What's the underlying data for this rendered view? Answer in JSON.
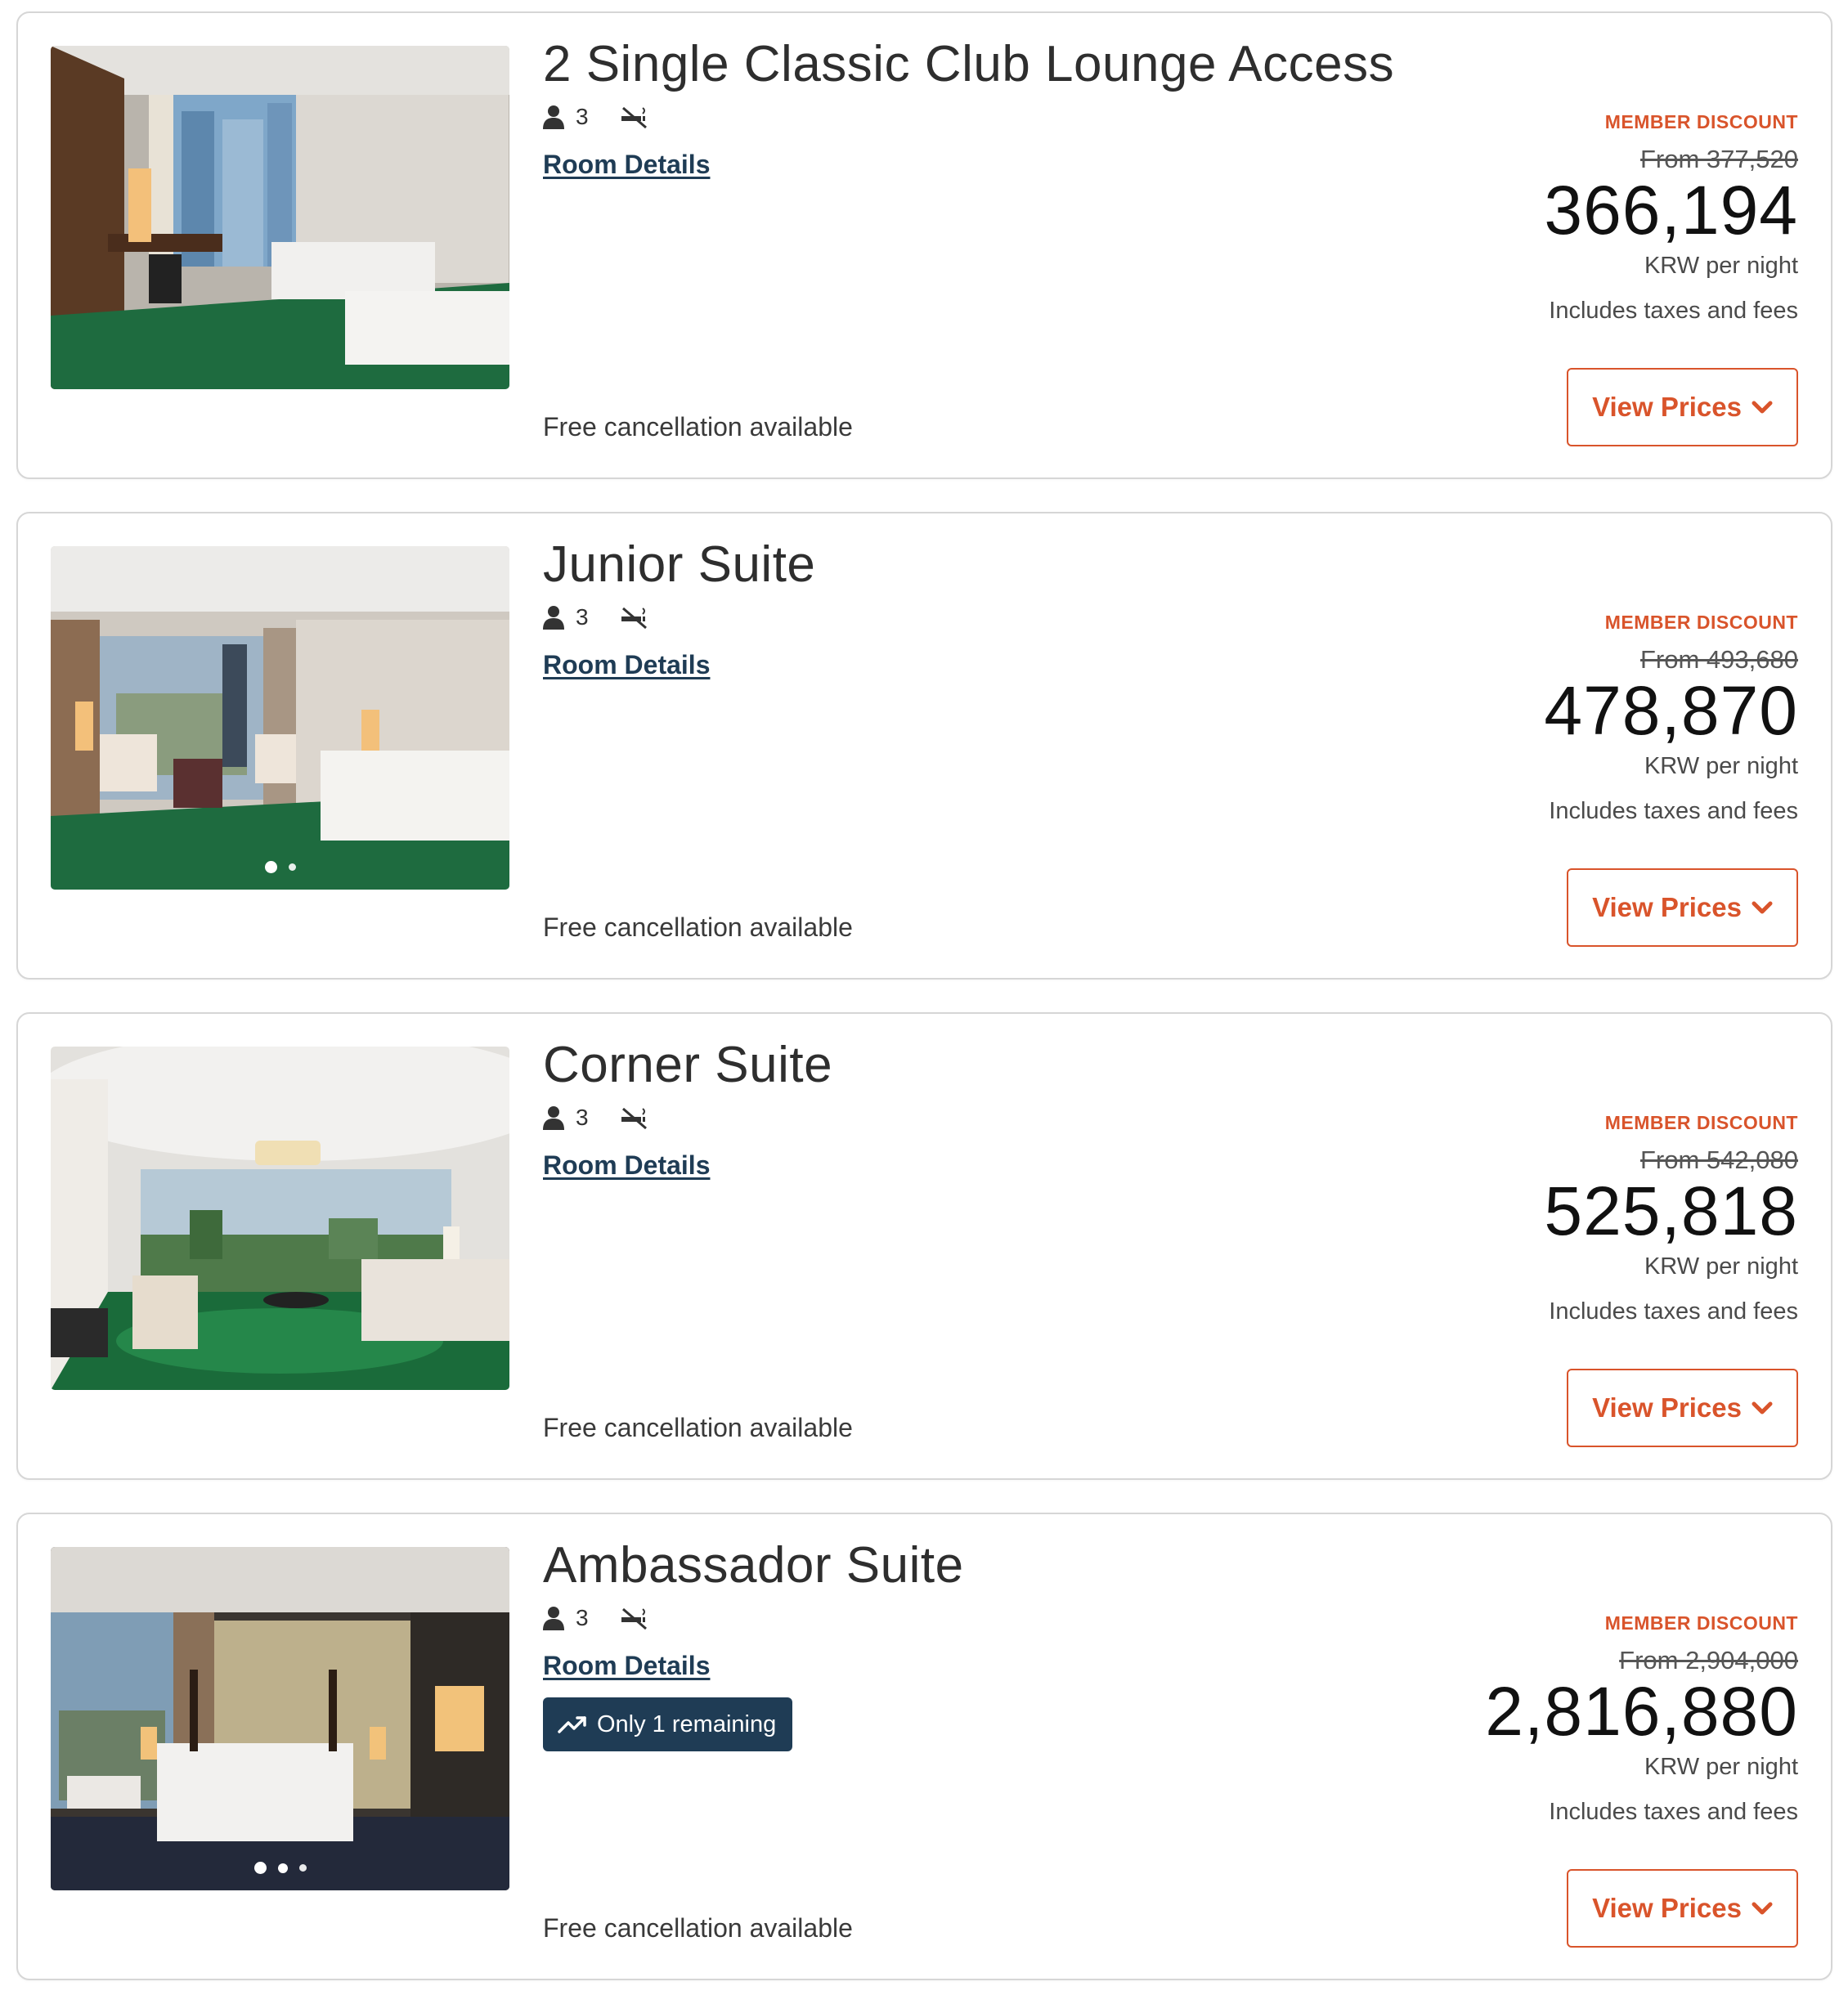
{
  "rooms": [
    {
      "name": "2 Single Classic Club Lounge Access",
      "occupancy": "3",
      "details_link": "Room Details",
      "badge": "",
      "cancellation": "Free cancellation available",
      "member_discount": "MEMBER DISCOUNT",
      "from_price": "From 377,520",
      "price": "366,194",
      "per_night": "KRW per night",
      "taxes": "Includes taxes and fees",
      "button": "View Prices",
      "photo_dots": 0
    },
    {
      "name": "Junior Suite",
      "occupancy": "3",
      "details_link": "Room Details",
      "badge": "",
      "cancellation": "Free cancellation available",
      "member_discount": "MEMBER DISCOUNT",
      "from_price": "From 493,680",
      "price": "478,870",
      "per_night": "KRW per night",
      "taxes": "Includes taxes and fees",
      "button": "View Prices",
      "photo_dots": 2
    },
    {
      "name": "Corner Suite",
      "occupancy": "3",
      "details_link": "Room Details",
      "badge": "",
      "cancellation": "Free cancellation available",
      "member_discount": "MEMBER DISCOUNT",
      "from_price": "From 542,080",
      "price": "525,818",
      "per_night": "KRW per night",
      "taxes": "Includes taxes and fees",
      "button": "View Prices",
      "photo_dots": 0
    },
    {
      "name": "Ambassador Suite",
      "occupancy": "3",
      "details_link": "Room Details",
      "badge": "Only 1 remaining",
      "cancellation": "Free cancellation available",
      "member_discount": "MEMBER DISCOUNT",
      "from_price": "From 2,904,000",
      "price": "2,816,880",
      "per_night": "KRW per night",
      "taxes": "Includes taxes and fees",
      "button": "View Prices",
      "photo_dots": 3
    }
  ],
  "icons": {
    "occupancy": "person-icon",
    "smoking": "no-smoking-icon",
    "badge": "trending-up-icon",
    "button": "chevron-down-icon"
  },
  "colors": {
    "accent": "#d9542b",
    "navy": "#1f3c55",
    "border": "#d6d6d6",
    "carpet_green": "#1e6b3f"
  }
}
